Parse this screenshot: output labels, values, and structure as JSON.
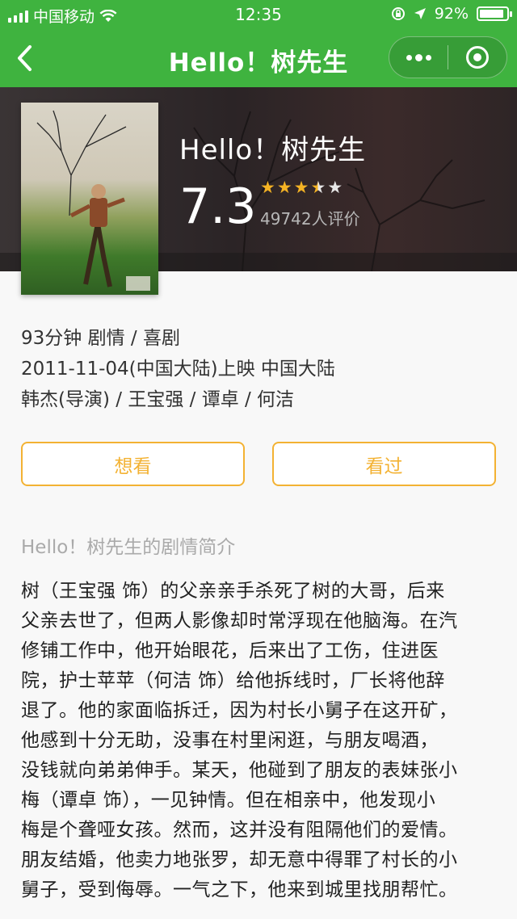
{
  "status_bar": {
    "carrier": "中国移动",
    "time": "12:35",
    "battery_percent": "92%",
    "battery_level": 0.92
  },
  "nav": {
    "title": "Hello！树先生",
    "back_icon": "chevron-left-icon",
    "more_icon": "more-dots-icon",
    "close_icon": "target-close-icon"
  },
  "movie": {
    "title": "Hello！树先生",
    "rating": "7.3",
    "stars_filled": 3.5,
    "stars_total": 5,
    "votes": "49742人评价",
    "meta_line1": "93分钟 剧情 / 喜剧",
    "meta_line2": "2011-11-04(中国大陆)上映 中国大陆",
    "meta_line3": "韩杰(导演) / 王宝强 / 谭卓 / 何洁"
  },
  "actions": {
    "want": "想看",
    "seen": "看过"
  },
  "summary": {
    "heading": "Hello！树先生的剧情简介",
    "lines": [
      "树（王宝强 饰）的父亲亲手杀死了树的大哥，后来",
      "父亲去世了，但两人影像却时常浮现在他脑海。在汽",
      "修铺工作中，他开始眼花，后来出了工伤，住进医",
      "院，护士苹苹（何洁 饰）给他拆线时，厂长将他辞",
      "退了。他的家面临拆迁，因为村长小舅子在这开矿，",
      "他感到十分无助，没事在村里闲逛，与朋友喝酒，",
      "没钱就向弟弟伸手。某天，他碰到了朋友的表妹张小",
      "梅（谭卓 饰），一见钟情。但在相亲中，他发现小",
      "梅是个聋哑女孩。然而，这并没有阻隔他们的爱情。",
      "朋友结婚，他卖力地张罗，却无意中得罪了村长的小",
      "舅子，受到侮辱。一气之下，他来到城里找朋帮忙。"
    ]
  },
  "colors": {
    "header_green": "#3fb33f",
    "accent_orange": "#f3b233",
    "star_gold": "#f5b324"
  }
}
